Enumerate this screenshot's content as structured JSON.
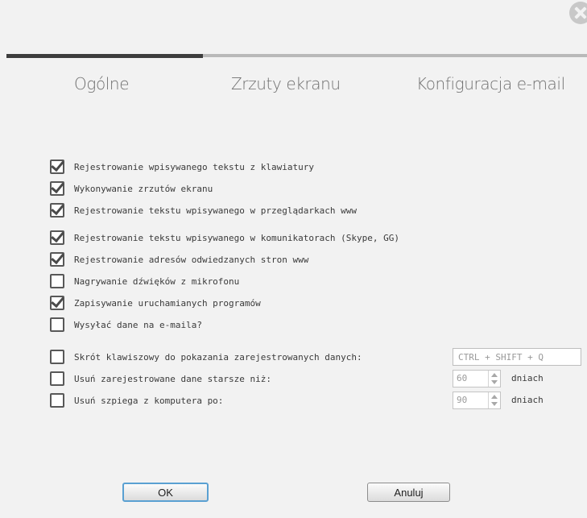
{
  "window": {
    "close_icon": "close-icon"
  },
  "tabs": [
    {
      "label": "Ogólne",
      "active": true
    },
    {
      "label": "Zrzuty ekranu",
      "active": false
    },
    {
      "label": "Konfiguracja e-mail",
      "active": false
    }
  ],
  "options": [
    {
      "label": "Rejestrowanie wpisywanego tekstu z klawiatury",
      "checked": true
    },
    {
      "label": "Wykonywanie zrzutów ekranu",
      "checked": true
    },
    {
      "label": "Rejestrowanie tekstu wpisywanego w przeglądarkach www",
      "checked": true
    },
    {
      "label": "Rejestrowanie tekstu wpisywanego w komunikatorach (Skype, GG)",
      "checked": true
    },
    {
      "label": "Rejestrowanie adresów odwiedzanych stron www",
      "checked": true
    },
    {
      "label": "Nagrywanie dźwięków z mikrofonu",
      "checked": false
    },
    {
      "label": "Zapisywanie uruchamianych programów",
      "checked": true
    },
    {
      "label": "Wysyłać dane na e-maila?",
      "checked": false
    }
  ],
  "extra_options": {
    "shortcut": {
      "label": "Skrót klawiszowy do pokazania zarejestrowanych danych:",
      "checked": false,
      "value": "CTRL + SHIFT + Q"
    },
    "delete_older": {
      "label": "Usuń zarejestrowane dane starsze niż:",
      "checked": false,
      "value": "60",
      "unit": "dniach"
    },
    "remove_spy": {
      "label": "Usuń szpiega z komputera po:",
      "checked": false,
      "value": "90",
      "unit": "dniach"
    }
  },
  "buttons": {
    "ok_label": "OK",
    "cancel_label": "Anuluj"
  },
  "colors": {
    "background": "#f2f2f2",
    "active_tab_bar": "#3d3d3d",
    "inactive_tab_bar": "#b9b9b9",
    "ok_focus_border": "#5aa0d2"
  }
}
